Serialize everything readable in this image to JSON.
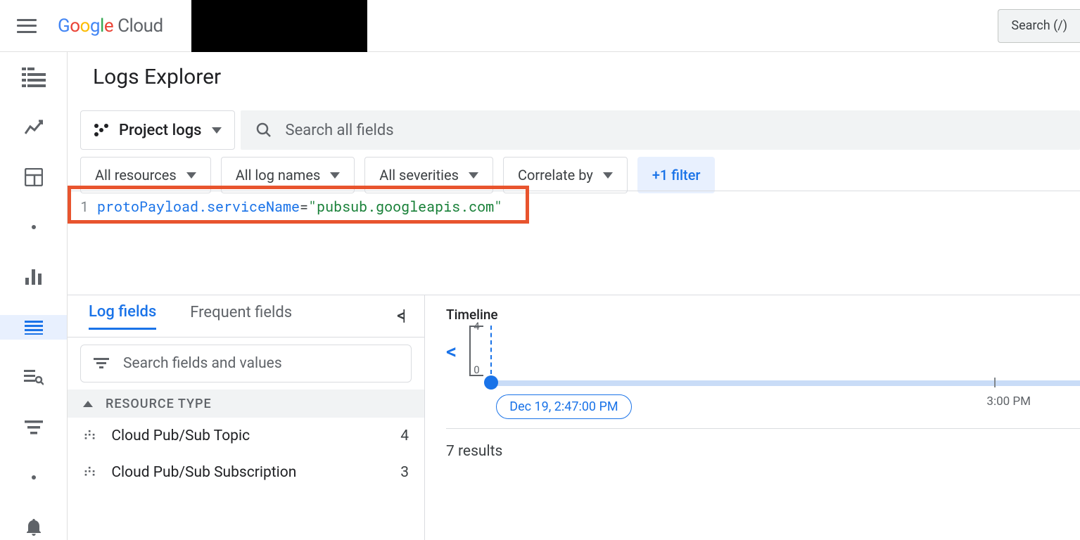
{
  "header": {
    "product": "Google Cloud",
    "search_button": "Search (/)"
  },
  "page": {
    "title": "Logs Explorer"
  },
  "scope": {
    "label": "Project logs",
    "search_placeholder": "Search all fields"
  },
  "filters": {
    "resources": "All resources",
    "lognames": "All log names",
    "severities": "All severities",
    "correlate": "Correlate by",
    "more": "+1 filter"
  },
  "query": {
    "lineno": "1",
    "key": "protoPayload.serviceName",
    "op": "=",
    "val": "\"pubsub.googleapis.com\""
  },
  "tabs": {
    "log_fields": "Log fields",
    "frequent": "Frequent fields"
  },
  "fields": {
    "search_placeholder": "Search fields and values",
    "group_label": "RESOURCE TYPE",
    "rows": [
      {
        "label": "Cloud Pub/Sub Topic",
        "count": "4"
      },
      {
        "label": "Cloud Pub/Sub Subscription",
        "count": "3"
      }
    ]
  },
  "timeline": {
    "label": "Timeline",
    "max": "4",
    "min": "0",
    "pill": "Dec 19, 2:47:00 PM",
    "three_pm": "3:00 PM"
  },
  "results": "7 results"
}
